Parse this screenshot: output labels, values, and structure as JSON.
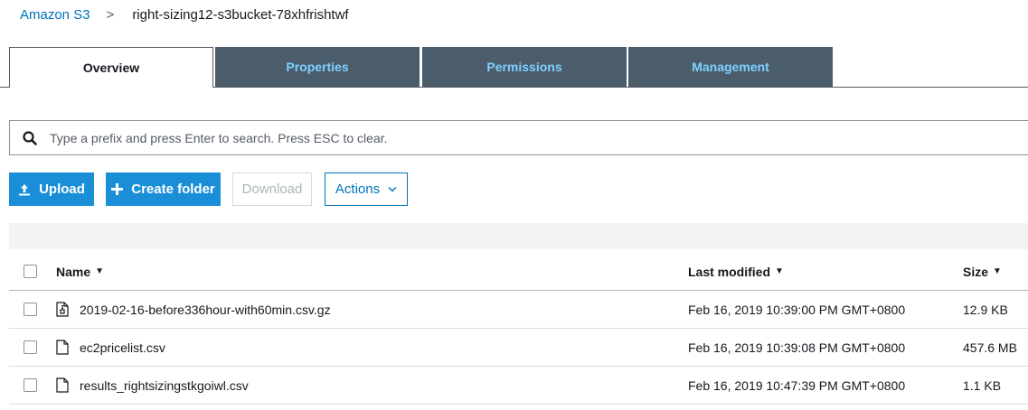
{
  "breadcrumb": {
    "root": "Amazon S3",
    "separator": ">",
    "current": "right-sizing12-s3bucket-78xhfrishtwf"
  },
  "tabs": [
    {
      "label": "Overview",
      "active": true
    },
    {
      "label": "Properties",
      "active": false
    },
    {
      "label": "Permissions",
      "active": false
    },
    {
      "label": "Management",
      "active": false
    }
  ],
  "search": {
    "placeholder": "Type a prefix and press Enter to search. Press ESC to clear.",
    "value": ""
  },
  "toolbar": {
    "upload_label": "Upload",
    "create_folder_label": "Create folder",
    "download_label": "Download",
    "actions_label": "Actions"
  },
  "table": {
    "columns": {
      "name": "Name",
      "last_modified": "Last modified",
      "size": "Size"
    },
    "rows": [
      {
        "name": "2019-02-16-before336hour-with60min.csv.gz",
        "icon": "archive-file-icon",
        "last_modified": "Feb 16, 2019 10:39:00 PM GMT+0800",
        "size": "12.9 KB"
      },
      {
        "name": "ec2pricelist.csv",
        "icon": "file-icon",
        "last_modified": "Feb 16, 2019 10:39:08 PM GMT+0800",
        "size": "457.6 MB"
      },
      {
        "name": "results_rightsizingstkgoiwl.csv",
        "icon": "file-icon",
        "last_modified": "Feb 16, 2019 10:47:39 PM GMT+0800",
        "size": "1.1 KB"
      }
    ]
  },
  "colors": {
    "link": "#0073bb",
    "tab_inactive_bg": "#4b5d6b",
    "tab_inactive_text": "#7fd0ff",
    "primary_button": "#1a8fd8"
  }
}
